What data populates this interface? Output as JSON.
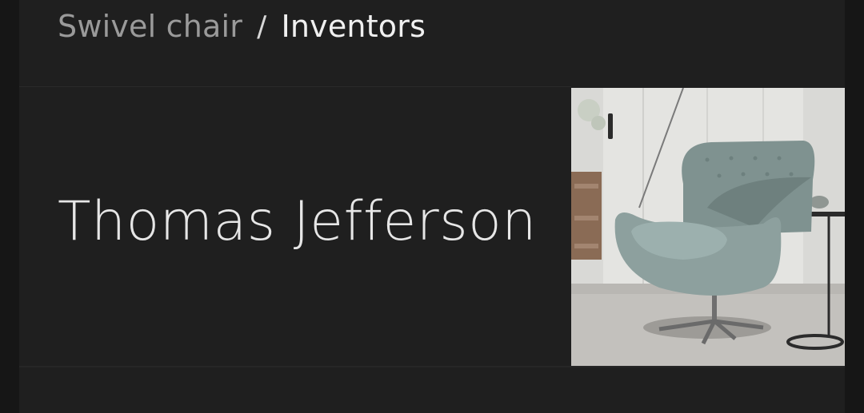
{
  "breadcrumb": {
    "parent": "Swivel chair",
    "separator": "/",
    "current": "Inventors"
  },
  "entry": {
    "name": "Thomas Jefferson",
    "image_alt": "swivel-chair-photo"
  },
  "colors": {
    "background": "#161616",
    "card": "#1f1f1f",
    "text_primary": "#e6e6e6",
    "text_muted": "#9a9a9a"
  }
}
